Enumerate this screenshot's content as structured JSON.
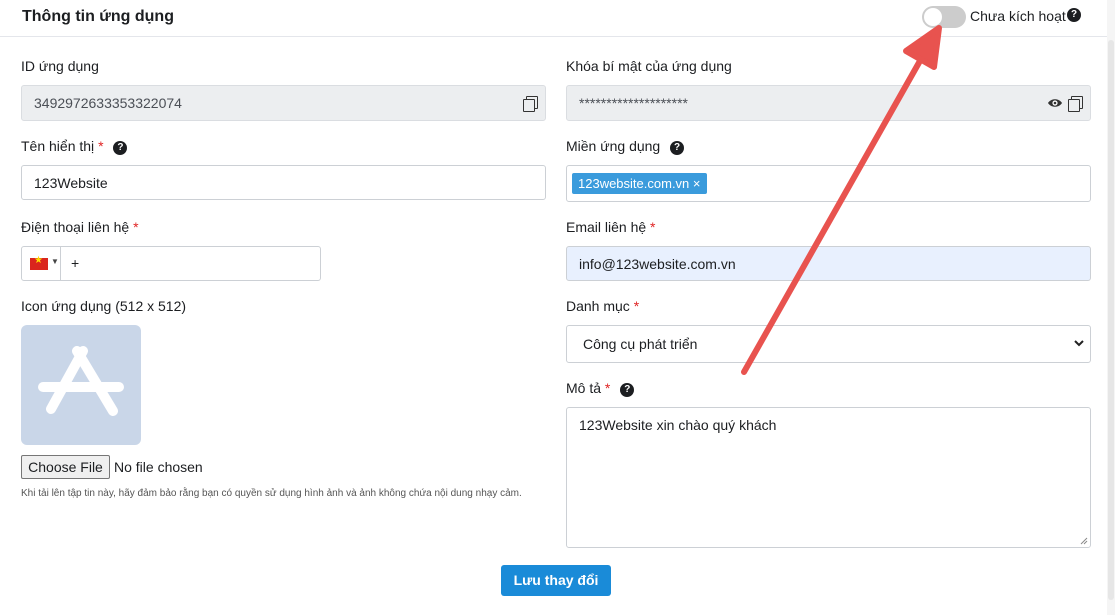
{
  "header": {
    "title": "Thông tin ứng dụng",
    "toggle_label": "Chưa kích hoạt",
    "toggle_on": false
  },
  "app_id": {
    "label": "ID ứng dụng",
    "value": "3492972633353322074"
  },
  "secret": {
    "label": "Khóa bí mật của ứng dụng",
    "value": "********************"
  },
  "display_name": {
    "label": "Tên hiển thị",
    "value": "123Website"
  },
  "domain": {
    "label": "Miền ứng dụng",
    "tag": "123website.com.vn"
  },
  "phone": {
    "label": "Điện thoại liên hệ",
    "value": "+",
    "country": "VN"
  },
  "email": {
    "label": "Email liên hệ",
    "value": "info@123website.com.vn"
  },
  "icon": {
    "label": "Icon ứng dụng (512 x 512)",
    "choose_label": "Choose File",
    "status": "No file chosen",
    "note": "Khi tải lên tập tin này, hãy đảm bảo rằng bạn có quyền sử dụng hình ảnh và ảnh không chứa nội dung nhạy cảm."
  },
  "category": {
    "label": "Danh mục",
    "selected": "Công cụ phát triển"
  },
  "description": {
    "label": "Mô tả",
    "value": "123Website xin chào quý khách"
  },
  "save_label": "Lưu thay đổi",
  "required_mark": "*",
  "help_glyph": "?",
  "tag_remove": "×",
  "colors": {
    "primary": "#1a8bd8",
    "tag": "#3a9bdc",
    "arrow": "#e8534f",
    "required": "#e02424"
  }
}
